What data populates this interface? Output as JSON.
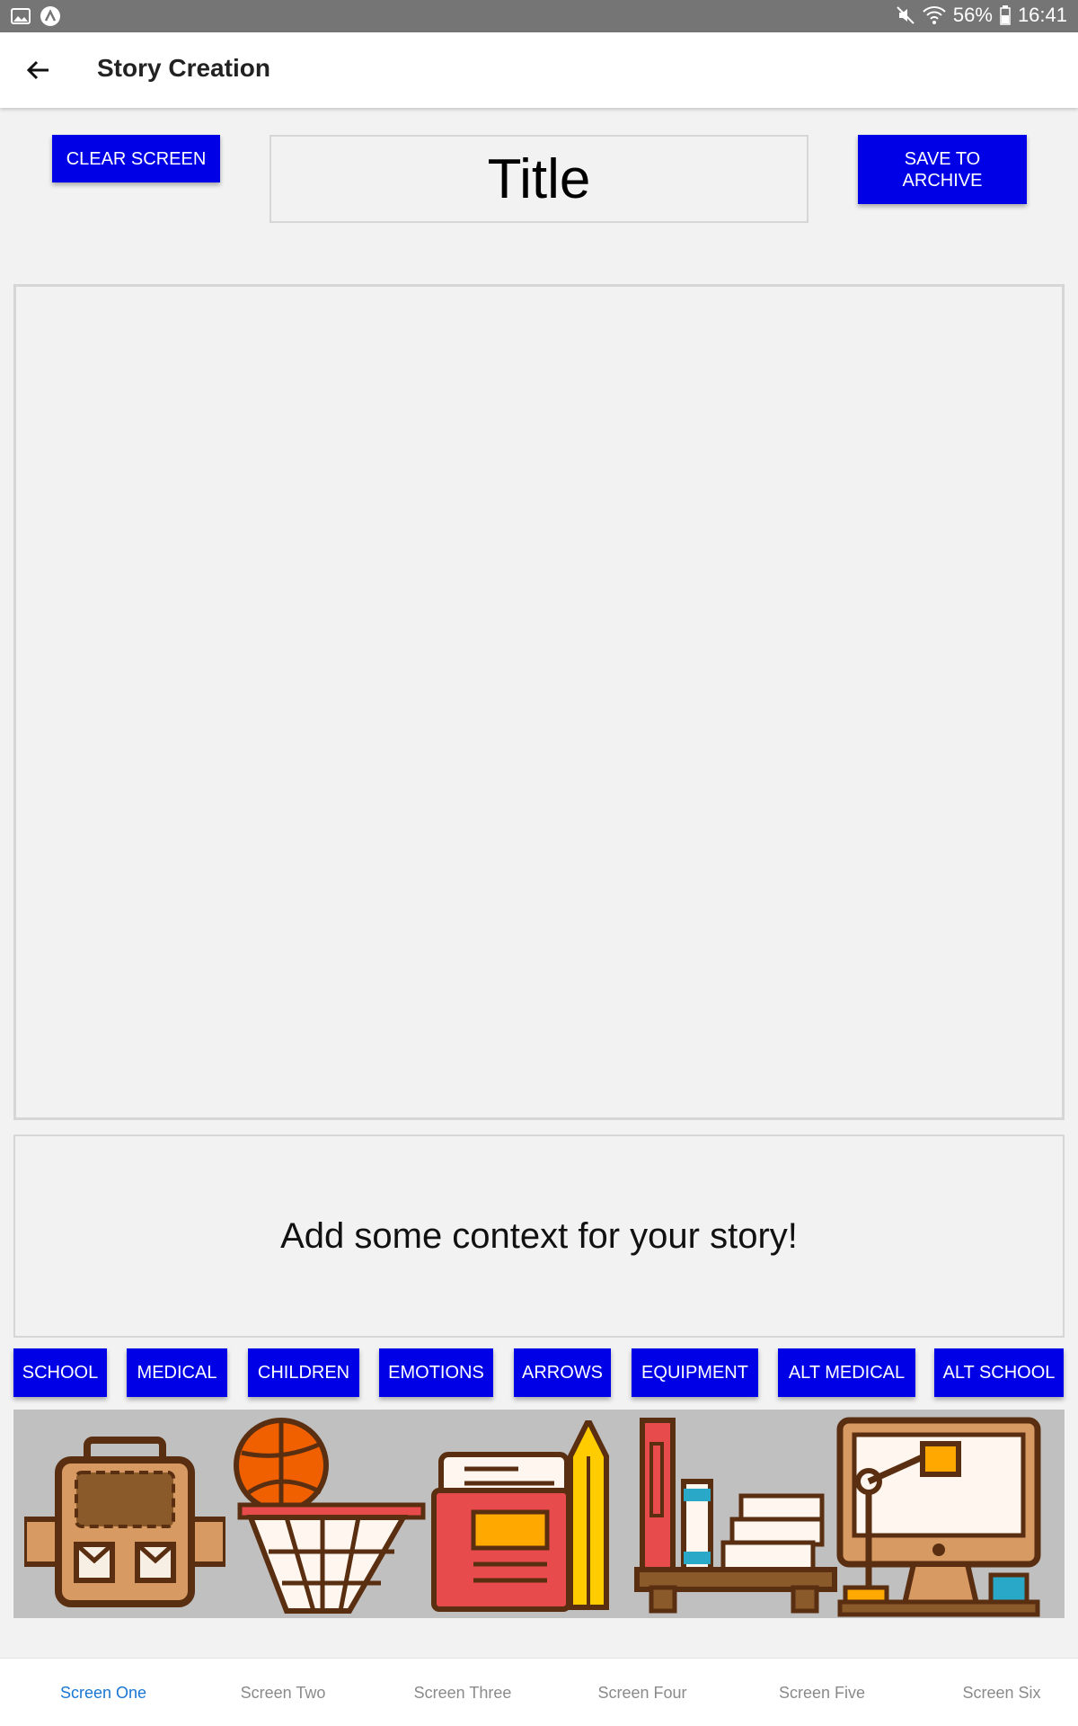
{
  "status_bar": {
    "battery": "56%",
    "time": "16:41",
    "icons": [
      "image-icon",
      "app-icon",
      "mute-icon",
      "wifi-icon",
      "battery-icon"
    ]
  },
  "app_bar": {
    "title": "Story Creation",
    "back_icon": "back-arrow-icon"
  },
  "toolbar": {
    "clear_label": "CLEAR SCREEN",
    "save_label": "SAVE TO ARCHIVE",
    "title_value": "Title"
  },
  "context": {
    "placeholder": "Add some context for your story!"
  },
  "categories": [
    "SCHOOL",
    "MEDICAL",
    "CHILDREN",
    "EMOTIONS",
    "ARROWS",
    "EQUIPMENT",
    "ALT MEDICAL",
    "ALT SCHOOL"
  ],
  "stickers": [
    "backpack-sticker",
    "basketball-hoop-sticker",
    "books-pencil-sticker",
    "desk-books-sticker",
    "computer-lamp-sticker"
  ],
  "tabs": [
    {
      "label": "Screen One",
      "active": true
    },
    {
      "label": "Screen Two",
      "active": false
    },
    {
      "label": "Screen Three",
      "active": false
    },
    {
      "label": "Screen Four",
      "active": false
    },
    {
      "label": "Screen Five",
      "active": false
    },
    {
      "label": "Screen Six",
      "active": false
    }
  ],
  "colors": {
    "accent_button": "#0000e6",
    "active_tab": "#1976d2",
    "status_bar": "#757575"
  }
}
